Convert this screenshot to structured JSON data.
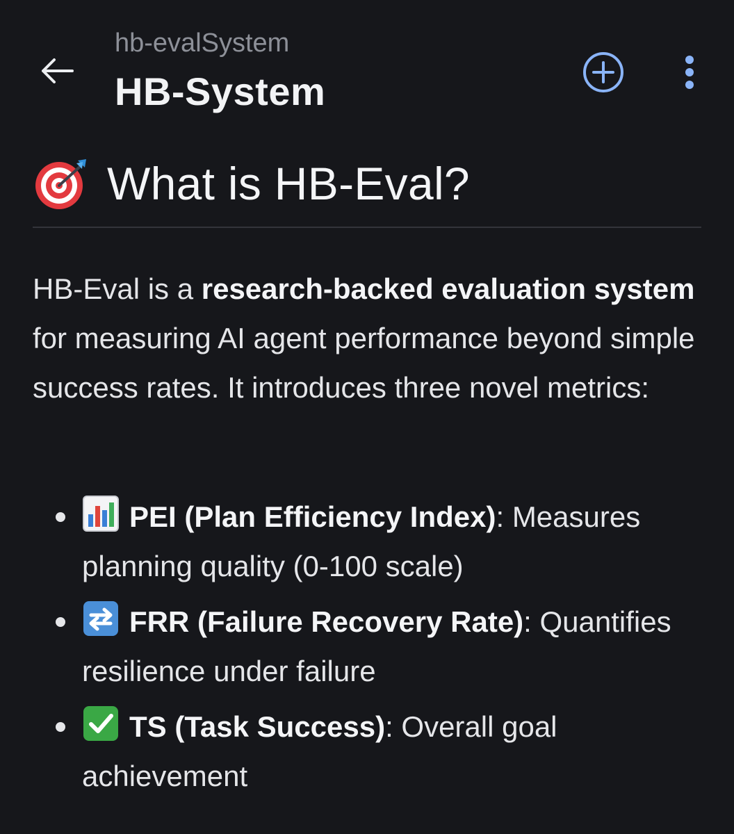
{
  "header": {
    "back_icon": "arrow-left-icon",
    "owner": "hb-evalSystem",
    "repo": "HB-System",
    "add_icon": "plus-circle-icon",
    "more_icon": "more-vertical-icon",
    "accent_color": "#8ab4f8"
  },
  "readme": {
    "heading_icon": "direct-hit-target-icon",
    "heading": "What is HB-Eval?",
    "intro": {
      "part1": "HB-Eval is a ",
      "bold": "research-backed evaluation system",
      "part2": " for measuring AI agent performance beyond simple success rates. It introduces three novel metrics:"
    },
    "metrics": [
      {
        "icon": "bar-chart-icon",
        "name": "PEI (Plan Efficiency Index)",
        "colon": ":",
        "description": " Measures planning quality (0-100 scale)"
      },
      {
        "icon": "arrows-cycle-icon",
        "name": "FRR (Failure Recovery Rate)",
        "colon": ":",
        "description": " Quantifies resilience under failure"
      },
      {
        "icon": "check-mark-icon",
        "name": "TS (Task Success)",
        "colon": ":",
        "description": " Overall goal achievement"
      }
    ]
  }
}
